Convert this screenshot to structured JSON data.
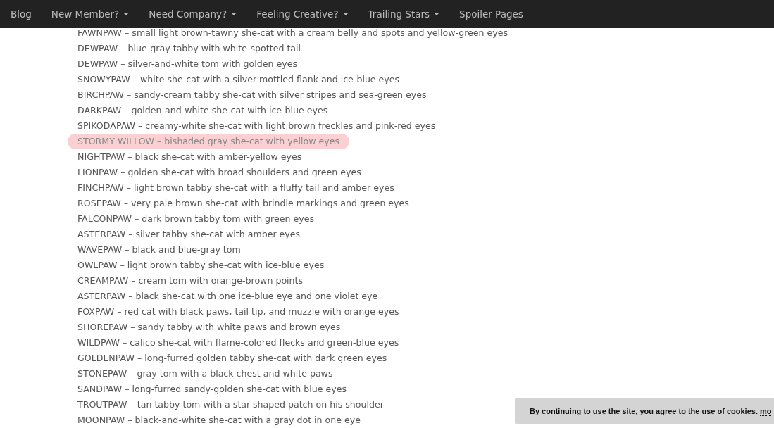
{
  "nav": [
    {
      "label": "Blog",
      "dropdown": false
    },
    {
      "label": "New Member?",
      "dropdown": true
    },
    {
      "label": "Need Company?",
      "dropdown": true
    },
    {
      "label": "Feeling Creative?",
      "dropdown": true
    },
    {
      "label": "Trailing Stars",
      "dropdown": true
    },
    {
      "label": "Spoiler Pages",
      "dropdown": false
    }
  ],
  "entries": [
    {
      "text": "FAWNPAW – small light brown-tawny she-cat with a cream belly and spots and yellow-green eyes",
      "highlighted": false
    },
    {
      "text": "DEWPAW – blue-gray tabby with white-spotted tail",
      "highlighted": false
    },
    {
      "text": "DEWPAW – silver-and-white tom with golden eyes",
      "highlighted": false
    },
    {
      "text": "SNOWYPAW – white she-cat with a silver-mottled flank and ice-blue eyes",
      "highlighted": false
    },
    {
      "text": "BIRCHPAW – sandy-cream tabby she-cat with silver stripes and sea-green eyes",
      "highlighted": false
    },
    {
      "text": "DARKPAW – golden-and-white she-cat with ice-blue eyes",
      "highlighted": false
    },
    {
      "text": "SPIKODAPAW – creamy-white she-cat with light brown freckles and pink-red eyes",
      "highlighted": false
    },
    {
      "text": "STORMY WILLOW – bishaded gray she-cat with yellow eyes",
      "highlighted": true
    },
    {
      "text": "NIGHTPAW – black she-cat with amber-yellow eyes",
      "highlighted": false
    },
    {
      "text": "LIONPAW – golden she-cat with broad shoulders and green eyes",
      "highlighted": false
    },
    {
      "text": "FINCHPAW – light brown tabby she-cat with a fluffy tail and amber eyes",
      "highlighted": false
    },
    {
      "text": "ROSEPAW – very pale brown she-cat with brindle markings and green eyes",
      "highlighted": false
    },
    {
      "text": "FALCONPAW – dark brown tabby tom with green eyes",
      "highlighted": false
    },
    {
      "text": "ASTERPAW – silver tabby she-cat with amber eyes",
      "highlighted": false
    },
    {
      "text": "WAVEPAW – black and blue-gray tom",
      "highlighted": false
    },
    {
      "text": "OWLPAW – light brown tabby she-cat with ice-blue eyes",
      "highlighted": false
    },
    {
      "text": "CREAMPAW – cream tom with orange-brown points",
      "highlighted": false
    },
    {
      "text": "ASTERPAW – black she-cat with one ice-blue eye and one violet eye",
      "highlighted": false
    },
    {
      "text": "FOXPAW – red cat with black paws, tail tip, and muzzle with orange eyes",
      "highlighted": false
    },
    {
      "text": "SHOREPAW – sandy tabby with white paws and brown eyes",
      "highlighted": false
    },
    {
      "text": "WILDPAW – calico she-cat with flame-colored flecks and green-blue eyes",
      "highlighted": false
    },
    {
      "text": "GOLDENPAW – long-furred golden tabby she-cat with dark green eyes",
      "highlighted": false
    },
    {
      "text": "STONEPAW – gray tom with a black chest and white paws",
      "highlighted": false
    },
    {
      "text": "SANDPAW – long-furred sandy-golden she-cat with blue eyes",
      "highlighted": false
    },
    {
      "text": "TROUTPAW – tan tabby tom with a star-shaped patch on his shoulder",
      "highlighted": false
    },
    {
      "text": "MOONPAW – black-and-white she-cat with a gray dot in one eye",
      "highlighted": false
    }
  ],
  "cookie_notice": {
    "text": "By continuing to use the site, you agree to the use of cookies.",
    "link": "mo"
  }
}
